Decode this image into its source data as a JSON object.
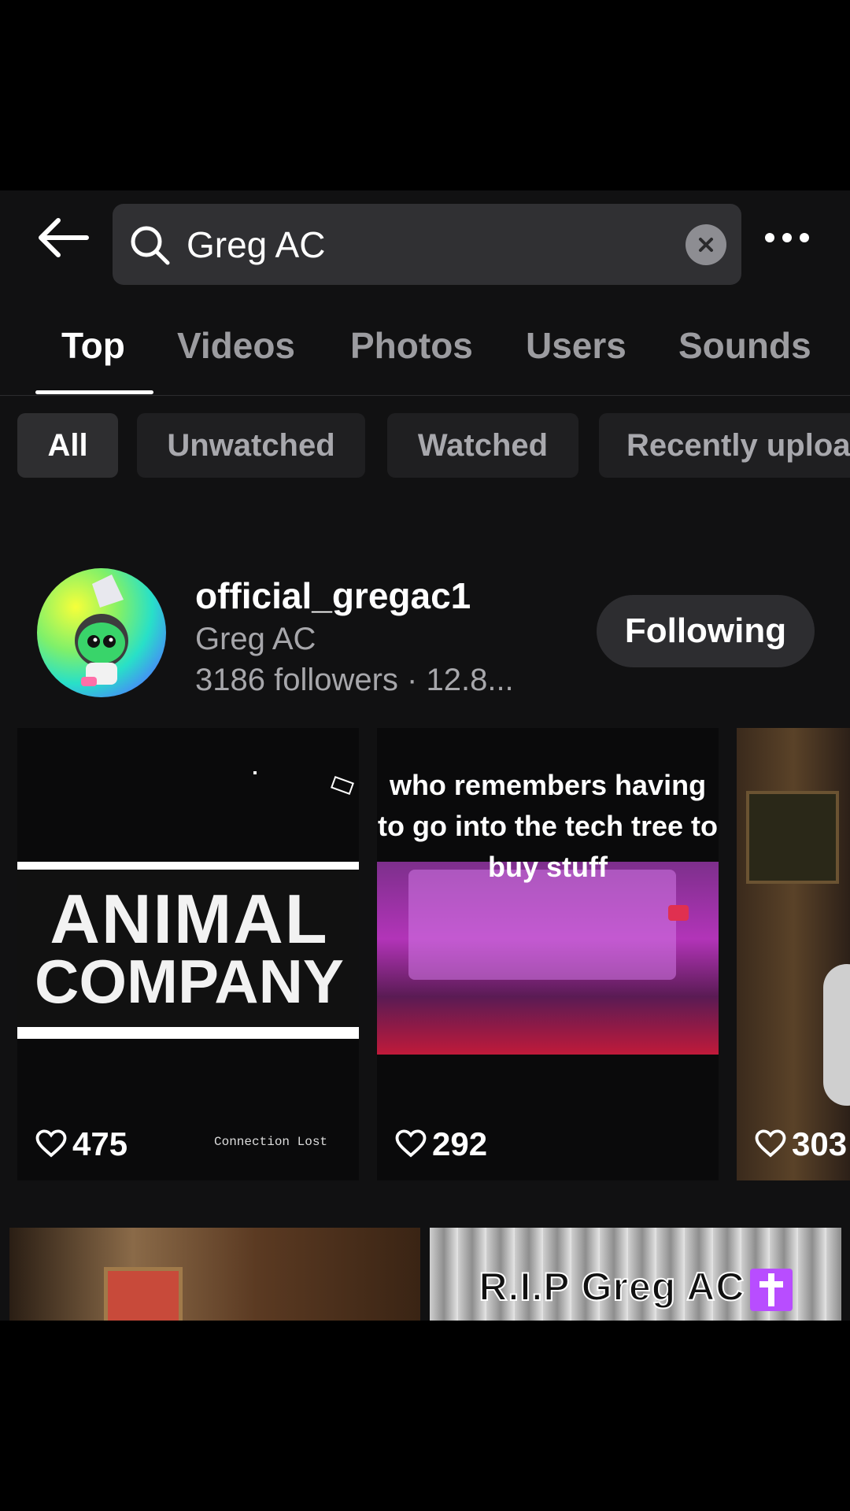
{
  "search": {
    "query": "Greg AC"
  },
  "tabs": [
    {
      "label": "Top",
      "active": true
    },
    {
      "label": "Videos",
      "active": false
    },
    {
      "label": "Photos",
      "active": false
    },
    {
      "label": "Users",
      "active": false
    },
    {
      "label": "Sounds",
      "active": false
    }
  ],
  "filters": [
    {
      "label": "All",
      "active": true
    },
    {
      "label": "Unwatched",
      "active": false
    },
    {
      "label": "Watched",
      "active": false
    },
    {
      "label": "Recently uploa",
      "active": false
    }
  ],
  "user": {
    "username": "official_gregac1",
    "display_name": "Greg AC",
    "stats": "3186 followers · 12.8...",
    "follow_label": "Following"
  },
  "videos": [
    {
      "title_line1": "ANIMAL",
      "title_line2": "COMPANY",
      "overlay": "Connection Lost",
      "likes": "475"
    },
    {
      "caption_line1": "who remembers having",
      "caption_line2": "to go into the tech tree to",
      "caption_line3": "buy stuff",
      "likes": "292"
    },
    {
      "likes": "303"
    }
  ],
  "second_row": [
    {
      "caption": ""
    },
    {
      "caption": "R.I.P Greg AC"
    }
  ],
  "icons": [
    "back-arrow-icon",
    "search-icon",
    "clear-icon",
    "more-icon",
    "heart-icon"
  ],
  "colors": {
    "background": "#111112",
    "search_field": "#303033",
    "inactive_text": "#9c9ca0"
  }
}
